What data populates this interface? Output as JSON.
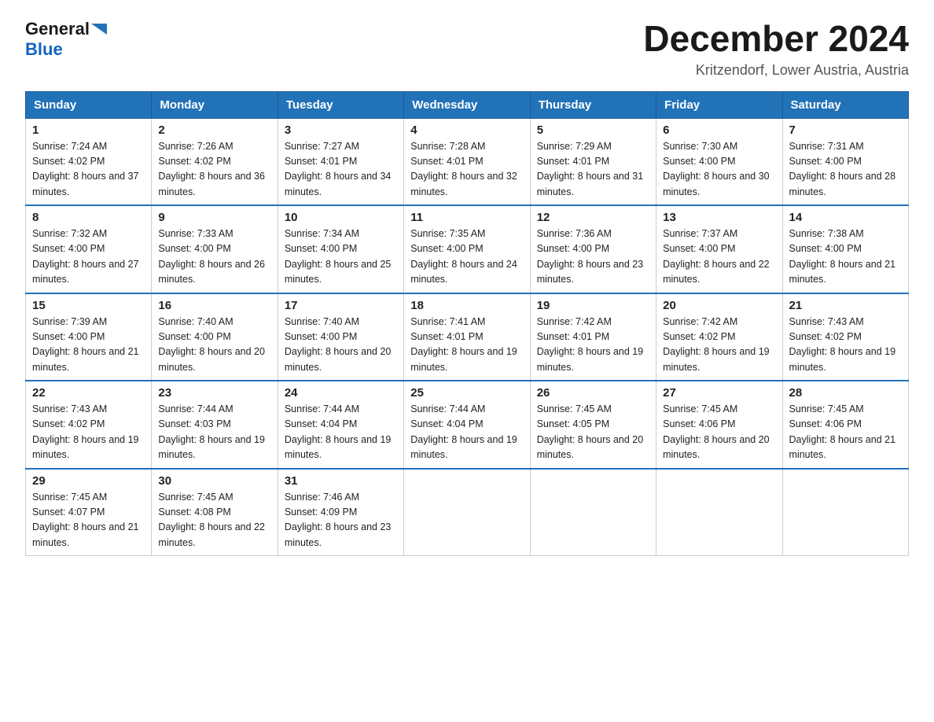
{
  "header": {
    "logo_general": "General",
    "logo_blue": "Blue",
    "month_title": "December 2024",
    "location": "Kritzendorf, Lower Austria, Austria"
  },
  "days_of_week": [
    "Sunday",
    "Monday",
    "Tuesday",
    "Wednesday",
    "Thursday",
    "Friday",
    "Saturday"
  ],
  "weeks": [
    [
      {
        "day": "1",
        "sunrise": "7:24 AM",
        "sunset": "4:02 PM",
        "daylight": "8 hours and 37 minutes."
      },
      {
        "day": "2",
        "sunrise": "7:26 AM",
        "sunset": "4:02 PM",
        "daylight": "8 hours and 36 minutes."
      },
      {
        "day": "3",
        "sunrise": "7:27 AM",
        "sunset": "4:01 PM",
        "daylight": "8 hours and 34 minutes."
      },
      {
        "day": "4",
        "sunrise": "7:28 AM",
        "sunset": "4:01 PM",
        "daylight": "8 hours and 32 minutes."
      },
      {
        "day": "5",
        "sunrise": "7:29 AM",
        "sunset": "4:01 PM",
        "daylight": "8 hours and 31 minutes."
      },
      {
        "day": "6",
        "sunrise": "7:30 AM",
        "sunset": "4:00 PM",
        "daylight": "8 hours and 30 minutes."
      },
      {
        "day": "7",
        "sunrise": "7:31 AM",
        "sunset": "4:00 PM",
        "daylight": "8 hours and 28 minutes."
      }
    ],
    [
      {
        "day": "8",
        "sunrise": "7:32 AM",
        "sunset": "4:00 PM",
        "daylight": "8 hours and 27 minutes."
      },
      {
        "day": "9",
        "sunrise": "7:33 AM",
        "sunset": "4:00 PM",
        "daylight": "8 hours and 26 minutes."
      },
      {
        "day": "10",
        "sunrise": "7:34 AM",
        "sunset": "4:00 PM",
        "daylight": "8 hours and 25 minutes."
      },
      {
        "day": "11",
        "sunrise": "7:35 AM",
        "sunset": "4:00 PM",
        "daylight": "8 hours and 24 minutes."
      },
      {
        "day": "12",
        "sunrise": "7:36 AM",
        "sunset": "4:00 PM",
        "daylight": "8 hours and 23 minutes."
      },
      {
        "day": "13",
        "sunrise": "7:37 AM",
        "sunset": "4:00 PM",
        "daylight": "8 hours and 22 minutes."
      },
      {
        "day": "14",
        "sunrise": "7:38 AM",
        "sunset": "4:00 PM",
        "daylight": "8 hours and 21 minutes."
      }
    ],
    [
      {
        "day": "15",
        "sunrise": "7:39 AM",
        "sunset": "4:00 PM",
        "daylight": "8 hours and 21 minutes."
      },
      {
        "day": "16",
        "sunrise": "7:40 AM",
        "sunset": "4:00 PM",
        "daylight": "8 hours and 20 minutes."
      },
      {
        "day": "17",
        "sunrise": "7:40 AM",
        "sunset": "4:00 PM",
        "daylight": "8 hours and 20 minutes."
      },
      {
        "day": "18",
        "sunrise": "7:41 AM",
        "sunset": "4:01 PM",
        "daylight": "8 hours and 19 minutes."
      },
      {
        "day": "19",
        "sunrise": "7:42 AM",
        "sunset": "4:01 PM",
        "daylight": "8 hours and 19 minutes."
      },
      {
        "day": "20",
        "sunrise": "7:42 AM",
        "sunset": "4:02 PM",
        "daylight": "8 hours and 19 minutes."
      },
      {
        "day": "21",
        "sunrise": "7:43 AM",
        "sunset": "4:02 PM",
        "daylight": "8 hours and 19 minutes."
      }
    ],
    [
      {
        "day": "22",
        "sunrise": "7:43 AM",
        "sunset": "4:02 PM",
        "daylight": "8 hours and 19 minutes."
      },
      {
        "day": "23",
        "sunrise": "7:44 AM",
        "sunset": "4:03 PM",
        "daylight": "8 hours and 19 minutes."
      },
      {
        "day": "24",
        "sunrise": "7:44 AM",
        "sunset": "4:04 PM",
        "daylight": "8 hours and 19 minutes."
      },
      {
        "day": "25",
        "sunrise": "7:44 AM",
        "sunset": "4:04 PM",
        "daylight": "8 hours and 19 minutes."
      },
      {
        "day": "26",
        "sunrise": "7:45 AM",
        "sunset": "4:05 PM",
        "daylight": "8 hours and 20 minutes."
      },
      {
        "day": "27",
        "sunrise": "7:45 AM",
        "sunset": "4:06 PM",
        "daylight": "8 hours and 20 minutes."
      },
      {
        "day": "28",
        "sunrise": "7:45 AM",
        "sunset": "4:06 PM",
        "daylight": "8 hours and 21 minutes."
      }
    ],
    [
      {
        "day": "29",
        "sunrise": "7:45 AM",
        "sunset": "4:07 PM",
        "daylight": "8 hours and 21 minutes."
      },
      {
        "day": "30",
        "sunrise": "7:45 AM",
        "sunset": "4:08 PM",
        "daylight": "8 hours and 22 minutes."
      },
      {
        "day": "31",
        "sunrise": "7:46 AM",
        "sunset": "4:09 PM",
        "daylight": "8 hours and 23 minutes."
      },
      null,
      null,
      null,
      null
    ]
  ]
}
